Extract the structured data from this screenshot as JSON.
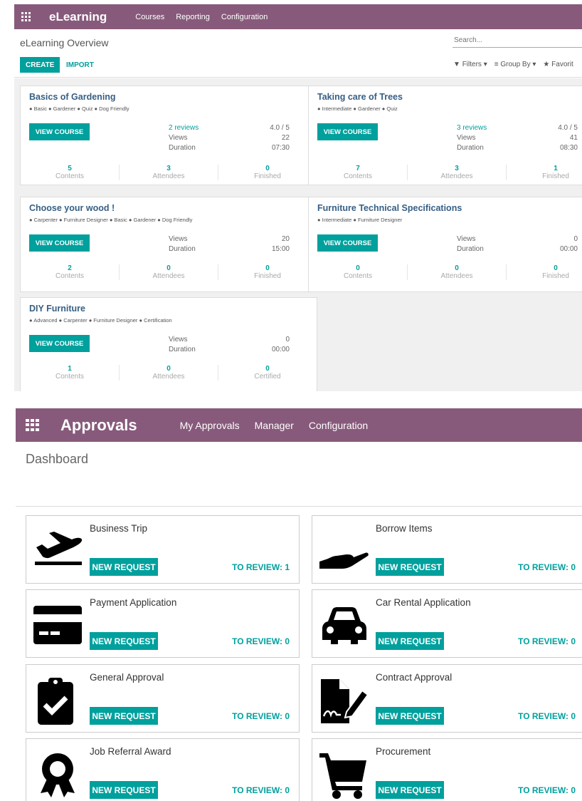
{
  "elearning": {
    "app_title": "eLearning",
    "menu": [
      "Courses",
      "Reporting",
      "Configuration"
    ],
    "breadcrumb": "eLearning Overview",
    "search_placeholder": "Search...",
    "create_label": "CREATE",
    "import_label": "IMPORT",
    "filters_label": "Filters",
    "groupby_label": "Group By",
    "favorites_label": "Favorit",
    "courses": [
      {
        "title": "Basics of Gardening",
        "tags": "● Basic ● Gardener ● Quiz ● Dog Friendly",
        "button": "VIEW COURSE",
        "stats": [
          {
            "label": "2 reviews",
            "value": "4.0 / 5"
          },
          {
            "label": "Views",
            "value": "22"
          },
          {
            "label": "Duration",
            "value": "07:30"
          }
        ],
        "counters": [
          {
            "num": "5",
            "label": "Contents"
          },
          {
            "num": "3",
            "label": "Attendees"
          },
          {
            "num": "0",
            "label": "Finished"
          }
        ]
      },
      {
        "title": "Taking care of Trees",
        "tags": "● Intermediate ● Gardener ● Quiz",
        "button": "VIEW COURSE",
        "stats": [
          {
            "label": "3 reviews",
            "value": "4.0 / 5"
          },
          {
            "label": "Views",
            "value": "41"
          },
          {
            "label": "Duration",
            "value": "08:30"
          }
        ],
        "counters": [
          {
            "num": "7",
            "label": "Contents"
          },
          {
            "num": "3",
            "label": "Attendees"
          },
          {
            "num": "1",
            "label": "Finished"
          }
        ]
      },
      {
        "title": "Choose your wood !",
        "tags": "● Carpenter ● Furniture Designer ● Basic ● Gardener ● Dog Friendly",
        "button": "VIEW COURSE",
        "stats": [
          {
            "label": "Views",
            "value": "20"
          },
          {
            "label": "Duration",
            "value": "15:00"
          }
        ],
        "counters": [
          {
            "num": "2",
            "label": "Contents"
          },
          {
            "num": "0",
            "label": "Attendees"
          },
          {
            "num": "0",
            "label": "Finished"
          }
        ]
      },
      {
        "title": "Furniture Technical Specifications",
        "tags": "● Intermediate ● Furniture Designer",
        "button": "VIEW COURSE",
        "stats": [
          {
            "label": "Views",
            "value": "0"
          },
          {
            "label": "Duration",
            "value": "00:00"
          }
        ],
        "counters": [
          {
            "num": "0",
            "label": "Contents"
          },
          {
            "num": "0",
            "label": "Attendees"
          },
          {
            "num": "0",
            "label": "Finished"
          }
        ]
      },
      {
        "title": "DIY Furniture",
        "tags": "● Advanced ● Carpenter ● Furniture Designer ● Certification",
        "button": "VIEW COURSE",
        "stats": [
          {
            "label": "Views",
            "value": "0"
          },
          {
            "label": "Duration",
            "value": "00:00"
          }
        ],
        "counters": [
          {
            "num": "1",
            "label": "Contents"
          },
          {
            "num": "0",
            "label": "Attendees"
          },
          {
            "num": "0",
            "label": "Certified"
          }
        ]
      }
    ]
  },
  "approvals": {
    "app_title": "Approvals",
    "menu": [
      "My Approvals",
      "Manager",
      "Configuration"
    ],
    "breadcrumb": "Dashboard",
    "categories": [
      {
        "title": "Business Trip",
        "icon": "plane-icon",
        "button": "NEW REQUEST",
        "review": "TO REVIEW: 1"
      },
      {
        "title": "Borrow Items",
        "icon": "hand-icon",
        "button": "NEW REQUEST",
        "review": "TO REVIEW: 0"
      },
      {
        "title": "Payment Application",
        "icon": "credit-card-icon",
        "button": "NEW REQUEST",
        "review": "TO REVIEW: 0"
      },
      {
        "title": "Car Rental Application",
        "icon": "car-icon",
        "button": "NEW REQUEST",
        "review": "TO REVIEW: 0"
      },
      {
        "title": "General Approval",
        "icon": "clipboard-check-icon",
        "button": "NEW REQUEST",
        "review": "TO REVIEW: 0"
      },
      {
        "title": "Contract Approval",
        "icon": "signed-document-icon",
        "button": "NEW REQUEST",
        "review": "TO REVIEW: 0"
      },
      {
        "title": "Job Referral Award",
        "icon": "award-icon",
        "button": "NEW REQUEST",
        "review": "TO REVIEW: 0"
      },
      {
        "title": "Procurement",
        "icon": "cart-icon",
        "button": "NEW REQUEST",
        "review": "TO REVIEW: 0"
      }
    ]
  },
  "colors": {
    "brand": "#875a7b",
    "accent": "#00a09d"
  }
}
